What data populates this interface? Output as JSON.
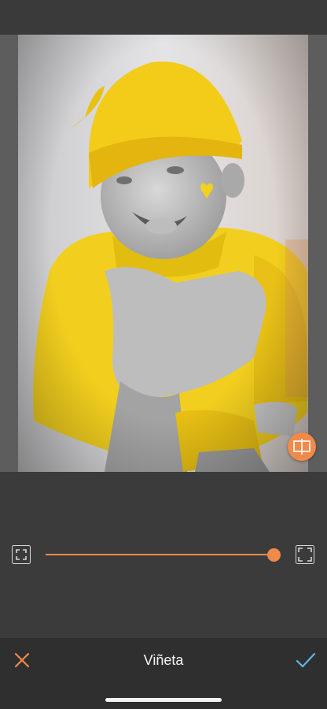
{
  "editor": {
    "tool_title": "Viñeta",
    "slider_value": 1.0
  },
  "icons": {
    "cancel": "close-x-icon",
    "confirm": "checkmark-icon",
    "frame_left": "frame-corners-small-icon",
    "frame_right": "frame-corners-large-icon",
    "compare": "split-compare-icon"
  },
  "colors": {
    "accent": "#f08a4b",
    "confirm": "#5bb8e8",
    "background": "#3b3b3c"
  }
}
